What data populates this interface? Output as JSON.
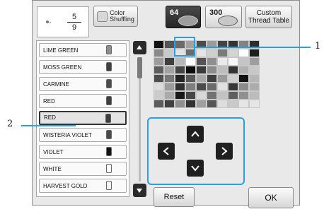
{
  "preview": {
    "counter_top": "5",
    "counter_bottom": "9"
  },
  "toolbar": {
    "shuffle_label_1": "Color",
    "shuffle_label_2": "Shuffling",
    "palette64_label": "64",
    "palette300_label": "300",
    "custom_label_1": "Custom",
    "custom_label_2": "Thread Table"
  },
  "thread_list": [
    {
      "name": "LIME GREEN",
      "spool_color": "#8f8f8f"
    },
    {
      "name": "MOSS GREEN",
      "spool_color": "#3e3e3e"
    },
    {
      "name": "CARMINE",
      "spool_color": "#4b4b4b"
    },
    {
      "name": "RED",
      "spool_color": "#3d3d3d"
    },
    {
      "name": "RED",
      "spool_color": "#3d3d3d",
      "selected": true
    },
    {
      "name": "WISTERIA VIOLET",
      "spool_color": "#4a4a4a"
    },
    {
      "name": "VIOLET",
      "spool_color": "#121212"
    },
    {
      "name": "WHITE",
      "spool_color": "#ffffff"
    },
    {
      "name": "HARVEST GOLD",
      "spool_color": "#f3f3f3"
    }
  ],
  "palette": {
    "rows": 8,
    "cols": 10,
    "selected_index": 1
  },
  "buttons": {
    "reset": "Reset",
    "ok": "OK"
  },
  "callouts": {
    "one": "1",
    "two": "2"
  },
  "colors": {
    "accent": "#2aa0dc",
    "dark_button": "#1f1f1f"
  }
}
